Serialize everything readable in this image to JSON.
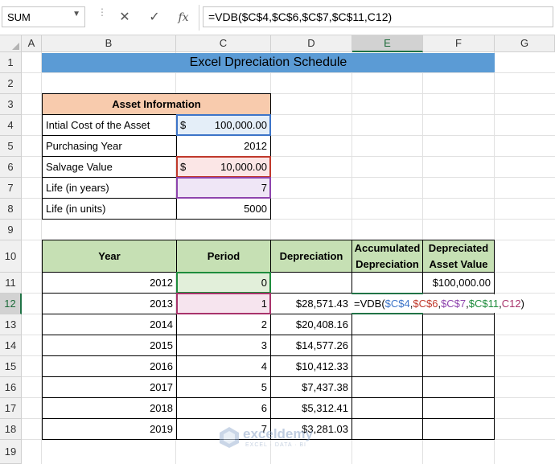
{
  "formula_bar": {
    "name_box": "SUM",
    "cancel_icon": "✕",
    "enter_icon": "✓",
    "fx_label": "fx",
    "formula": "=VDB($C$4,$C$6,$C$7,$C$11,C12)"
  },
  "columns": [
    "A",
    "B",
    "C",
    "D",
    "E",
    "F",
    "G"
  ],
  "rows": [
    "1",
    "2",
    "3",
    "4",
    "5",
    "6",
    "7",
    "8",
    "9",
    "10",
    "11",
    "12",
    "13",
    "14",
    "15",
    "16",
    "17",
    "18",
    "19"
  ],
  "title": "Excel Dpreciation Schedule",
  "asset_info": {
    "header": "Asset Information",
    "cost_label": "Intial Cost of the Asset",
    "cost_currency": "$",
    "cost_value": "100,000.00",
    "year_label": "Purchasing Year",
    "year_value": "2012",
    "salvage_label": "Salvage Value",
    "salvage_currency": "$",
    "salvage_value": "10,000.00",
    "life_years_label": "Life (in years)",
    "life_years_value": "7",
    "life_units_label": "Life (in units)",
    "life_units_value": "5000"
  },
  "schedule": {
    "headers": {
      "year": "Year",
      "period": "Period",
      "depreciation": "Depreciation",
      "accumulated_1": "Accumulated",
      "accumulated_2": "Depreciation",
      "depreciated_1": "Depreciated",
      "depreciated_2": "Asset Value"
    },
    "rows": [
      {
        "year": "2012",
        "period": "0",
        "depreciation": "",
        "accumulated": "",
        "asset_value": "$100,000.00"
      },
      {
        "year": "2013",
        "period": "1",
        "depreciation": "$28,571.43",
        "accumulated": "",
        "asset_value": ""
      },
      {
        "year": "2014",
        "period": "2",
        "depreciation": "$20,408.16",
        "accumulated": "",
        "asset_value": ""
      },
      {
        "year": "2015",
        "period": "3",
        "depreciation": "$14,577.26",
        "accumulated": "",
        "asset_value": ""
      },
      {
        "year": "2016",
        "period": "4",
        "depreciation": "$10,412.33",
        "accumulated": "",
        "asset_value": ""
      },
      {
        "year": "2017",
        "period": "5",
        "depreciation": "$7,437.38",
        "accumulated": "",
        "asset_value": ""
      },
      {
        "year": "2018",
        "period": "6",
        "depreciation": "$5,312.41",
        "accumulated": "",
        "asset_value": ""
      },
      {
        "year": "2019",
        "period": "7",
        "depreciation": "$3,281.03",
        "accumulated": "",
        "asset_value": ""
      }
    ],
    "editing_formula_parts": [
      "=VDB(",
      "$C$4",
      ",",
      "$C$6",
      ",",
      "$C$7",
      ",",
      "$C$11",
      ",",
      "C12",
      ")"
    ]
  },
  "watermark": {
    "brand": "exceldemy",
    "tagline": "EXCEL · DATA · BI"
  },
  "colors": {
    "title_bg": "#5b9bd5",
    "asset_header_bg": "#f8cbad",
    "schedule_header_bg": "#c6e0b4",
    "ref_blue": "#3c74c8",
    "ref_red": "#c0392b",
    "ref_purple": "#8e44ad",
    "ref_green": "#1e8c3c",
    "ref_magenta": "#a8336b",
    "excel_green": "#217346"
  }
}
